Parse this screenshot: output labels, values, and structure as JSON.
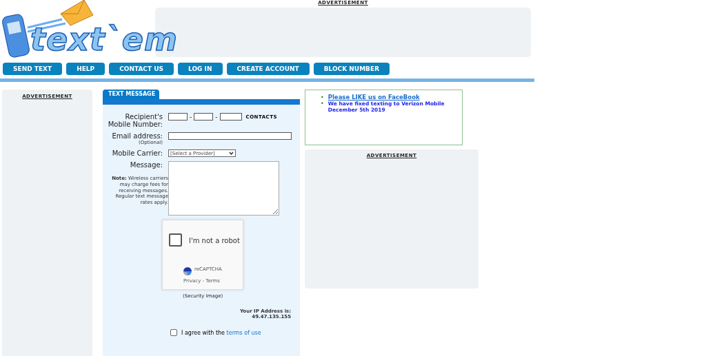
{
  "logo": {
    "text": "text`em"
  },
  "top_ad": {
    "label": "ADVERTISEMENT"
  },
  "nav": [
    "SEND TEXT",
    "HELP",
    "CONTACT US",
    "LOG IN",
    "CREATE ACCOUNT",
    "BLOCK NUMBER"
  ],
  "left_ad": {
    "label": "ADVERTISEMENT"
  },
  "form": {
    "tab": "TEXT MESSAGE",
    "recipient_label": "Recipient's Mobile Number:",
    "separators": [
      "-",
      "-"
    ],
    "contacts": "CONTACTS",
    "email_label": "Email address:",
    "email_hint": "(Optional)",
    "carrier_label": "Mobile Carrier:",
    "carrier_value": "[Select a Provider]",
    "message_label": "Message:",
    "note_bold": "Note:",
    "note": "Wireless carriers may charge fees for receiving messages. Regular text message rates apply.",
    "captcha": {
      "label": "I'm not a robot",
      "checked": false,
      "brand": "reCAPTCHA",
      "links": "Privacy - Terms"
    },
    "security_caption": "(Security Image)",
    "ip_label": "Your IP Address is:",
    "ip": "49.47.135.155",
    "agree": {
      "text": "I agree with the",
      "link": "terms of use",
      "checked": false
    }
  },
  "news": [
    {
      "bullet": "•",
      "text": "Please LIKE us on FaceBook",
      "kind": "link"
    },
    {
      "bullet": "•",
      "text": "We have fixed texting to Verizon Mobile December 5th 2019",
      "kind": "text"
    }
  ],
  "right_ad": {
    "label": "ADVERTISEMENT"
  }
}
